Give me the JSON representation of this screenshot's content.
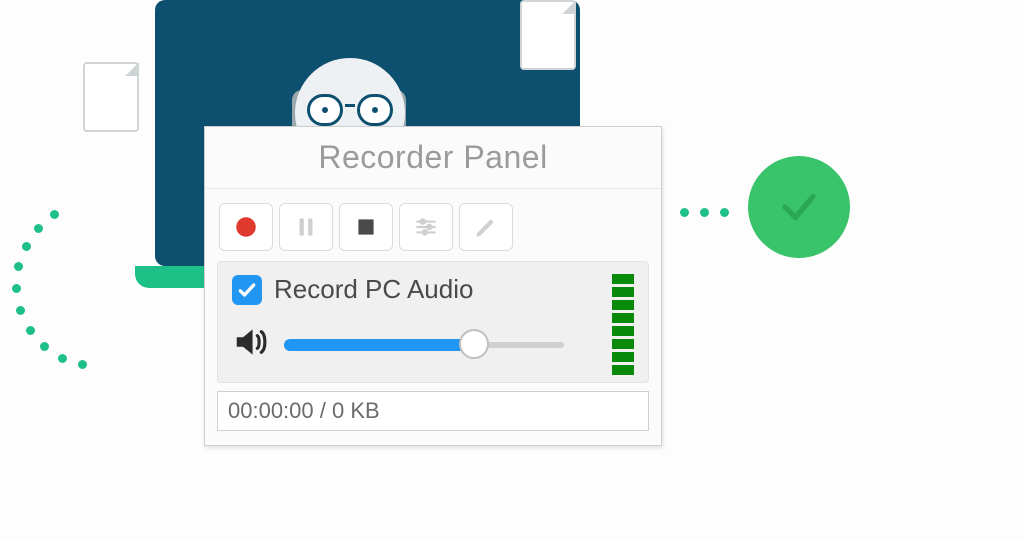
{
  "panel": {
    "title": "Recorder Panel",
    "buttons": {
      "record": "record",
      "pause": "pause",
      "stop": "stop",
      "settings": "settings",
      "edit": "edit"
    },
    "audio": {
      "checkbox_label": "Record PC Audio",
      "checked": true,
      "volume_percent": 68,
      "vu_levels": 8
    },
    "status": {
      "elapsed": "00:00:00",
      "size": "0 KB",
      "display": "00:00:00 / 0 KB"
    }
  },
  "colors": {
    "accent_blue": "#2196f3",
    "accent_green": "#1dc087",
    "brand_teal": "#0c4f6e",
    "check_green": "#39c36a",
    "record_red": "#e03a2f"
  }
}
